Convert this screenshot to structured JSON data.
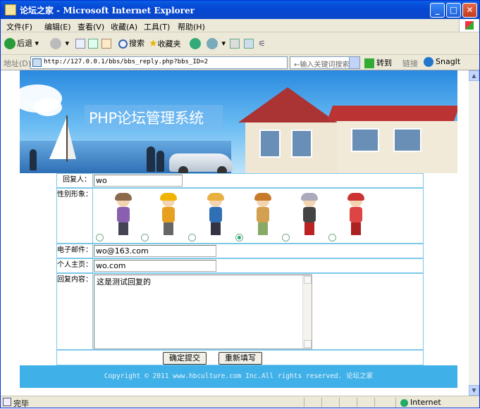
{
  "window": {
    "title": "论坛之家 - Microsoft Internet Explorer"
  },
  "menu": [
    "文件(F)",
    "编辑(E)",
    "查看(V)",
    "收藏(A)",
    "工具(T)",
    "帮助(H)"
  ],
  "toolbar": {
    "back": "后退",
    "search": "搜索",
    "favorites": "收藏夹"
  },
  "address": {
    "label": "地址(D)",
    "url": "http://127.0.0.1/bbs/bbs_reply.php?bbs_ID=2",
    "keyword_placeholder": "←输入关键词搜索",
    "go": "转到",
    "links": "链接",
    "snagit": "SnagIt"
  },
  "page": {
    "banner_title": "PHP论坛管理系统",
    "form": {
      "replier_label": "回复人：",
      "replier_value": "wo",
      "avatar_label": "性别形象：",
      "avatar_selected": 4,
      "email_label": "电子邮件：",
      "email_value": "wo@163.com",
      "homepage_label": "个人主页：",
      "homepage_value": "wo.com",
      "content_label": "回复内容：",
      "content_value": "这是测试回复的",
      "submit": "确定提交",
      "reset": "重新填写"
    },
    "footer": "Copyright © 2011 www.hbculture.com Inc.All rights reserved. 论坛之家"
  },
  "status": {
    "text": "完毕",
    "zone": "Internet"
  }
}
